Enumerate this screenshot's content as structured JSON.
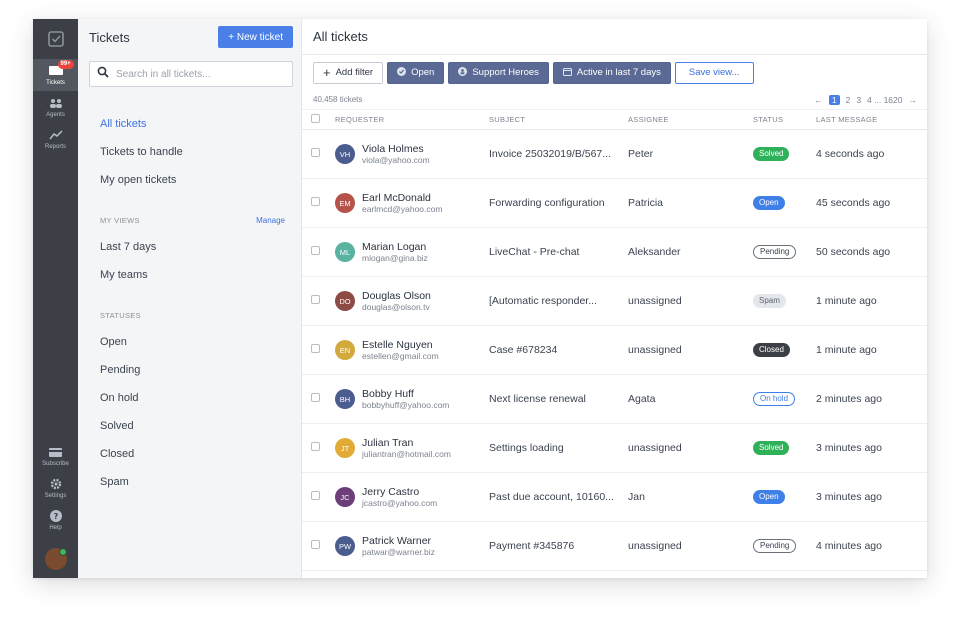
{
  "nav": {
    "items": [
      {
        "label": "Tickets",
        "badge": "99+",
        "icon": "ticket-icon"
      },
      {
        "label": "Agents",
        "icon": "agents-icon"
      },
      {
        "label": "Reports",
        "icon": "reports-icon"
      }
    ],
    "bottom": [
      {
        "label": "Subscribe",
        "icon": "card-icon"
      },
      {
        "label": "Settings",
        "icon": "gear-icon"
      },
      {
        "label": "Help",
        "icon": "help-icon"
      }
    ]
  },
  "sidebar": {
    "title": "Tickets",
    "new_button": "+ New ticket",
    "search_placeholder": "Search in all tickets...",
    "main_links": [
      "All tickets",
      "Tickets to handle",
      "My open tickets"
    ],
    "views_header": "MY VIEWS",
    "manage_label": "Manage",
    "views": [
      "Last 7 days",
      "My teams"
    ],
    "statuses_header": "STATUSES",
    "statuses": [
      "Open",
      "Pending",
      "On hold",
      "Solved",
      "Closed",
      "Spam"
    ]
  },
  "main": {
    "title": "All tickets",
    "filters": {
      "add_filter": "Add filter",
      "open": "Open",
      "support_heroes": "Support Heroes",
      "active": "Active in last 7 days",
      "save_view": "Save view..."
    },
    "count": "40,458 tickets",
    "pager": {
      "prev": "←",
      "current": "1",
      "pages": [
        "2",
        "3",
        "4 ... 1620"
      ],
      "next": "→"
    },
    "columns": {
      "requester": "REQUESTER",
      "subject": "SUBJECT",
      "assignee": "ASSIGNEE",
      "status": "STATUS",
      "last": "LAST MESSAGE"
    },
    "rows": [
      {
        "initials": "VH",
        "color": "#4b5c8e",
        "name": "Viola Holmes",
        "email": "viola@yahoo.com",
        "subject": "Invoice 25032019/B/567...",
        "assignee": "Peter",
        "status": "Solved",
        "status_type": "solved",
        "last": "4 seconds ago"
      },
      {
        "initials": "EM",
        "color": "#b5524a",
        "name": "Earl McDonald",
        "email": "earlmcd@yahoo.com",
        "subject": "Forwarding configuration",
        "assignee": "Patricia",
        "status": "Open",
        "status_type": "open",
        "last": "45 seconds ago"
      },
      {
        "initials": "ML",
        "color": "#5ab2a0",
        "name": "Marian Logan",
        "email": "mlogan@gina.biz",
        "subject": "LiveChat - Pre-chat",
        "assignee": "Aleksander",
        "status": "Pending",
        "status_type": "pending",
        "last": "50 seconds ago"
      },
      {
        "initials": "DO",
        "color": "#8e4a44",
        "name": "Douglas Olson",
        "email": "douglas@olson.tv",
        "subject": "[Automatic responder...",
        "assignee": "unassigned",
        "status": "Spam",
        "status_type": "spam",
        "last": "1 minute ago"
      },
      {
        "initials": "EN",
        "color": "#d3a93c",
        "name": "Estelle Nguyen",
        "email": "estellen@gmail.com",
        "subject": "Case #678234",
        "assignee": "unassigned",
        "status": "Closed",
        "status_type": "closed",
        "last": "1 minute ago"
      },
      {
        "initials": "BH",
        "color": "#4b5c8e",
        "name": "Bobby Huff",
        "email": "bobbyhuff@yahoo.com",
        "subject": "Next license renewal",
        "assignee": "Agata",
        "status": "On hold",
        "status_type": "onhold",
        "last": "2 minutes ago"
      },
      {
        "initials": "JT",
        "color": "#e1ab35",
        "name": "Julian Tran",
        "email": "juliantran@hotmail.com",
        "subject": "Settings loading",
        "assignee": "unassigned",
        "status": "Solved",
        "status_type": "solved",
        "last": "3 minutes ago"
      },
      {
        "initials": "JC",
        "color": "#6c3f7a",
        "name": "Jerry Castro",
        "email": "jcastro@yahoo.com",
        "subject": "Past due account, 10160...",
        "assignee": "Jan",
        "status": "Open",
        "status_type": "open",
        "last": "3 minutes ago"
      },
      {
        "initials": "PW",
        "color": "#4b5c8e",
        "name": "Patrick Warner",
        "email": "patwar@warner.biz",
        "subject": "Payment #345876",
        "assignee": "unassigned",
        "status": "Pending",
        "status_type": "pending",
        "last": "4 minutes ago"
      }
    ]
  }
}
